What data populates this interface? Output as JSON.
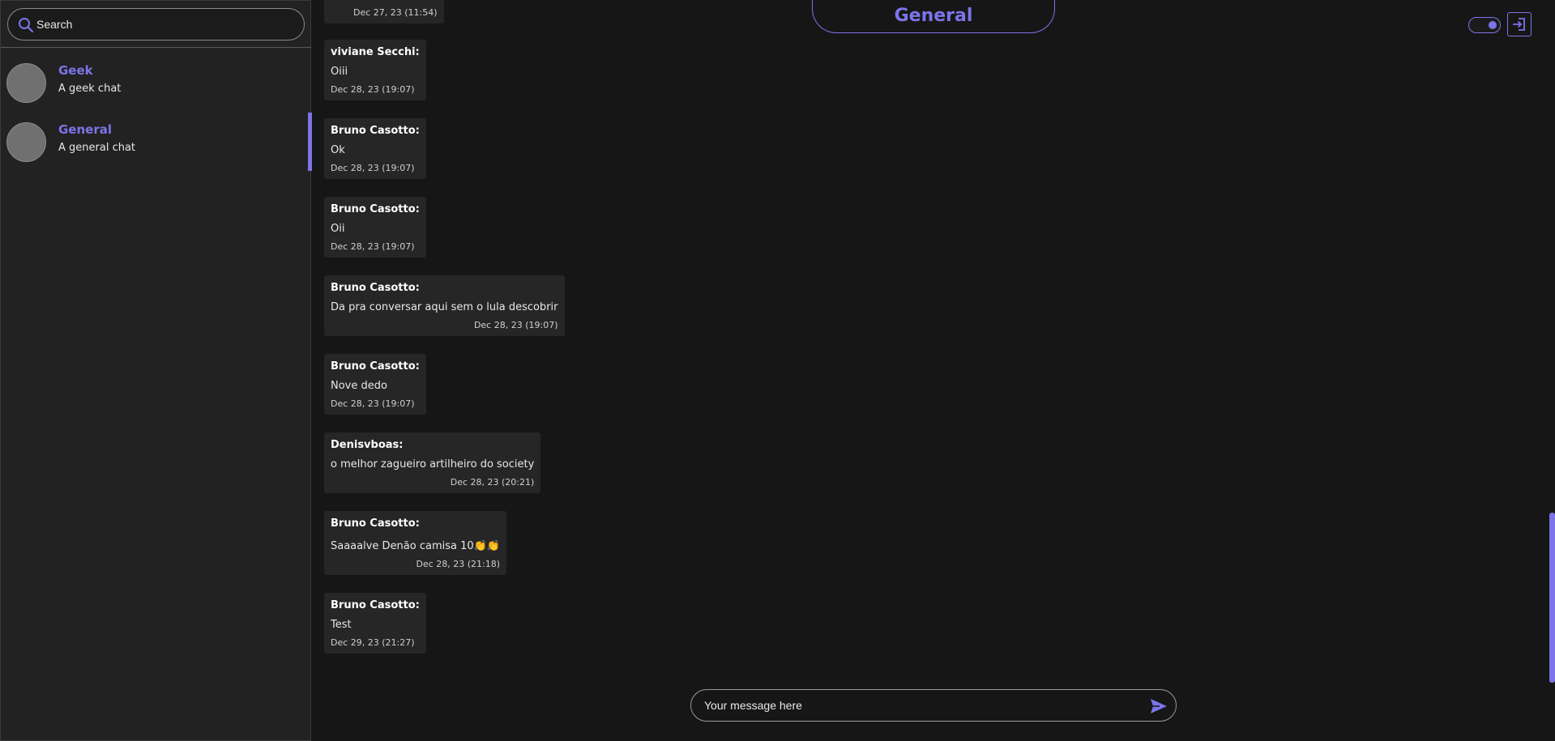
{
  "colors": {
    "accent": "#7c74e8",
    "background": "#161616",
    "sidebar": "#222222",
    "bubble": "#262626"
  },
  "search": {
    "placeholder": "Search",
    "icon": "search-icon"
  },
  "sidebar": {
    "chats": [
      {
        "name": "Geek",
        "description": "A geek chat",
        "active": false
      },
      {
        "name": "General",
        "description": "A general chat",
        "active": true
      }
    ]
  },
  "header": {
    "title": "General"
  },
  "toolbar": {
    "theme_toggle": "toggle-on",
    "logout_icon": "logout-icon"
  },
  "messages": [
    {
      "author": "",
      "text": "",
      "time": "Dec 27, 23 (11:54)"
    },
    {
      "author": "viviane Secchi:",
      "text": "Oiii",
      "time": "Dec 28, 23 (19:07)"
    },
    {
      "author": "Bruno Casotto:",
      "text": "Ok",
      "time": "Dec 28, 23 (19:07)"
    },
    {
      "author": "Bruno Casotto:",
      "text": "Oii",
      "time": "Dec 28, 23 (19:07)"
    },
    {
      "author": "Bruno Casotto:",
      "text": "Da pra conversar aqui sem o lula descobrir",
      "time": "Dec 28, 23 (19:07)"
    },
    {
      "author": "Bruno Casotto:",
      "text": "Nove dedo",
      "time": "Dec 28, 23 (19:07)"
    },
    {
      "author": "Denisvboas:",
      "text": "o melhor zagueiro artilheiro do society",
      "time": "Dec 28, 23 (20:21)"
    },
    {
      "author": "Bruno Casotto:",
      "text": "Saaaalve Denão camisa 10👏👏",
      "time": "Dec 28, 23 (21:18)"
    },
    {
      "author": "Bruno Casotto:",
      "text": "Test",
      "time": "Dec 29, 23 (21:27)"
    }
  ],
  "composer": {
    "placeholder": "Your message here",
    "send_icon": "send-icon"
  }
}
